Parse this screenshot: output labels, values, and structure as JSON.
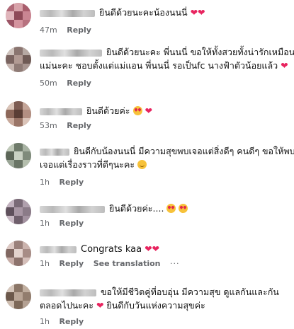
{
  "comments": [
    {
      "lines": [
        "ยินดีด้วยนะคะน้องนนนี่"
      ],
      "emoji_end": [
        "heart",
        "heart"
      ],
      "time": "47m",
      "reply": "Reply"
    },
    {
      "lines": [
        "ยินดีด้วยนะคะ พี่นนนี่ ขอให้ทั้งสวยทั้งน่ารักเหมือน",
        "แม่นะคะ ชอบตั้งแต่แม่แอน พี่นนนี่ รอเป็นfc นางฟ้าตัวน้อยแล้ว"
      ],
      "emoji_end": [
        "heart"
      ],
      "time": "50m",
      "reply": "Reply"
    },
    {
      "lines": [
        "ยินดีด้วยค่ะ"
      ],
      "emoji_end": [
        "heart-eyes",
        "heart"
      ],
      "time": "53m",
      "reply": "Reply"
    },
    {
      "lines": [
        "ยินดีกับน้องนนนี่ มีความสุขพบเจอแต่สิ่งดีๆ คนดีๆ ขอให้พบ",
        "เจอแต่เรื่องราวที่ดีๆนะคะ"
      ],
      "emoji_end": [
        "smile"
      ],
      "time": "1h",
      "reply": "Reply"
    },
    {
      "lines": [
        "ยินดีด้วยค่ะ...."
      ],
      "emoji_end": [
        "heart-eyes",
        "heart-eyes"
      ],
      "time": "1h",
      "reply": "Reply"
    },
    {
      "lines": [
        "Congrats kaa"
      ],
      "emoji_end": [
        "heart",
        "heart"
      ],
      "time": "1h",
      "reply": "Reply",
      "see_translation": "See translation",
      "more": "···"
    },
    {
      "lines": [
        "ขอให้มีชีวิตคู่ที่อบอุ่น มีความสุข ดูแลกันและกัน",
        "ตลอดไปนะคะ"
      ],
      "line2_tail": "ยินดีกับวันแห่งความสุขค่ะ",
      "time": "1h",
      "reply": "Reply"
    }
  ],
  "colors": {
    "heart": "#e8245f",
    "meta_text": "#65676b",
    "body_text": "#111111"
  }
}
